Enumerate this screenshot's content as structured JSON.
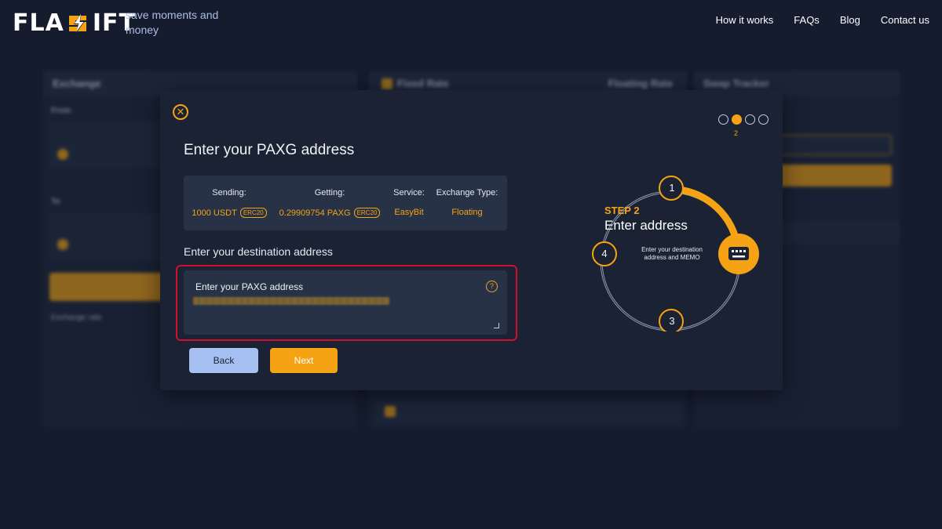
{
  "brand": {
    "logo_text_left": "FLA",
    "logo_text_right": "IFT",
    "tagline": "save moments and money",
    "accent": "#f5a314"
  },
  "nav": {
    "items": [
      "How it works",
      "FAQs",
      "Blog",
      "Contact us"
    ]
  },
  "background": {
    "exchange_title": "Exchange",
    "from_label": "From",
    "to_label": "To",
    "exchange_rate_label": "Exchange rate",
    "fixed_rate_label": "Fixed Rate",
    "floating_rate_label": "Floating Rate",
    "swap_tracker_title": "Swap Tracker"
  },
  "modal": {
    "title": "Enter your PAXG address",
    "summary": {
      "sending_label": "Sending:",
      "sending_value": "1000 USDT",
      "sending_chip": "ERC20",
      "getting_label": "Getting:",
      "getting_value": "0.29909754 PAXG",
      "getting_chip": "ERC20",
      "service_label": "Service:",
      "service_value": "EasyBit",
      "type_label": "Exchange Type:",
      "type_value": "Floating"
    },
    "destination_label": "Enter your destination address",
    "address_placeholder": "Enter your PAXG address",
    "help_icon": "?",
    "back_label": "Back",
    "next_label": "Next",
    "progress": {
      "current": "2",
      "total_steps": 4
    },
    "step": {
      "kicker": "STEP 2",
      "title": "Enter address",
      "description": "Enter your destination address and MEMO",
      "numbers": [
        "1",
        "3",
        "4"
      ],
      "icon": "keyboard-icon"
    },
    "close_icon": "close-icon"
  }
}
